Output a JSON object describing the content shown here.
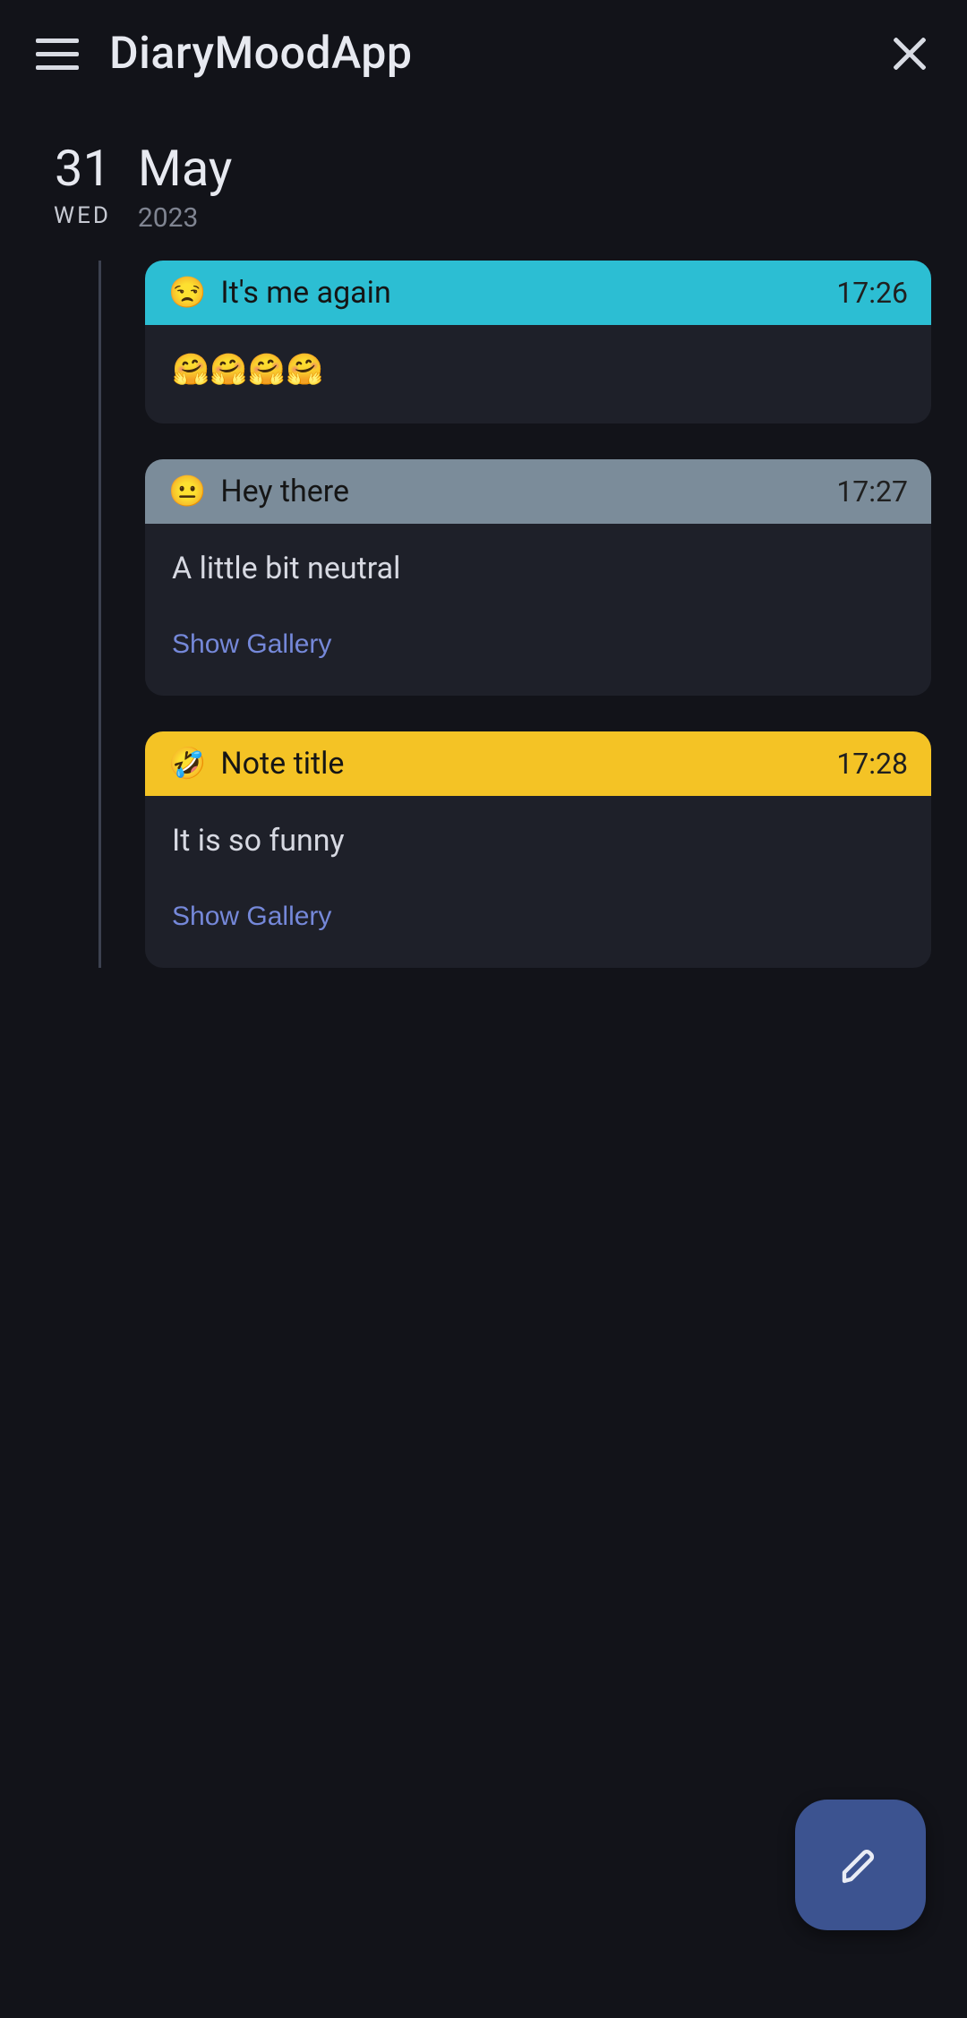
{
  "app": {
    "title": "DiaryMoodApp"
  },
  "date": {
    "day": "31",
    "weekday": "WED",
    "month": "May",
    "year": "2023"
  },
  "entries": [
    {
      "mood_emoji": "😒",
      "title": "It's me again",
      "time": "17:26",
      "body": "🤗🤗🤗🤗",
      "header_color": "#2cbed3",
      "show_gallery": false
    },
    {
      "mood_emoji": "😐",
      "title": "Hey there",
      "time": "17:27",
      "body": "A little bit neutral",
      "header_color": "#7b8c9a",
      "show_gallery": true
    },
    {
      "mood_emoji": "🤣",
      "title": "Note title",
      "time": "17:28",
      "body": "It is so funny",
      "header_color": "#f4c325",
      "show_gallery": true
    }
  ],
  "labels": {
    "show_gallery": "Show Gallery"
  },
  "icons": {
    "menu": "menu-icon",
    "close": "close-icon",
    "edit": "pencil-icon"
  }
}
